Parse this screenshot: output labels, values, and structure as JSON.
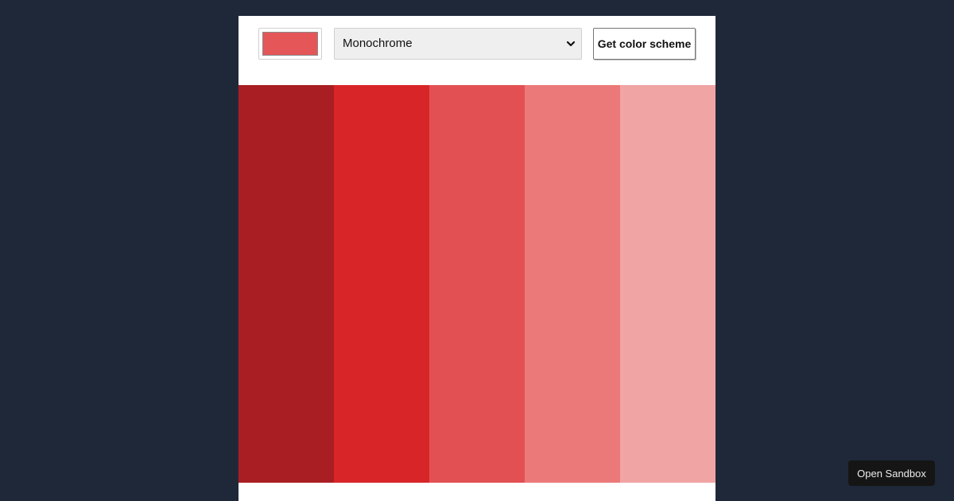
{
  "controls": {
    "seed_color": "#e45658",
    "scheme_select": {
      "selected": "Monochrome"
    },
    "get_scheme_label": "Get color scheme"
  },
  "palette": {
    "colors": [
      "#a91e22",
      "#d82527",
      "#e35053",
      "#ec7979",
      "#f1a4a4"
    ]
  },
  "sandbox": {
    "label": "Open Sandbox"
  },
  "icons": {
    "select_arrow": "chevron-down-icon"
  }
}
